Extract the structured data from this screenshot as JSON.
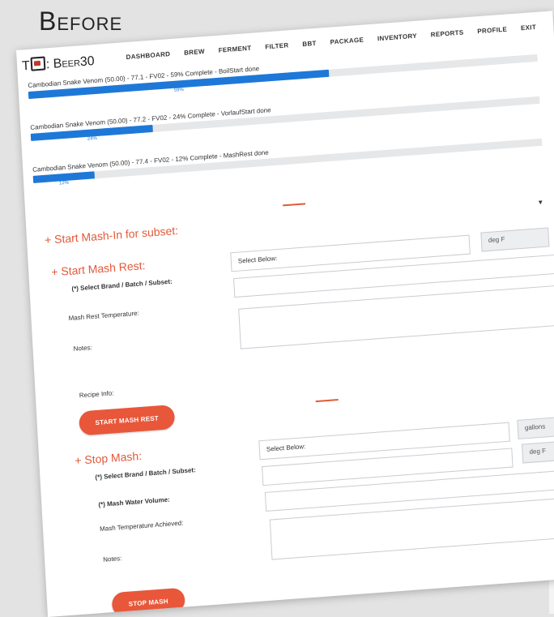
{
  "banner": {
    "title": "Before"
  },
  "app": {
    "brand_prefix": "T",
    "brand_suffix": ": Beer30",
    "nav": [
      "DASHBOARD",
      "BREW",
      "FERMENT",
      "FILTER",
      "BBT",
      "PACKAGE",
      "INVENTORY",
      "REPORTS",
      "PROFILE",
      "EXIT"
    ]
  },
  "jobs": [
    {
      "label": "Cambodian Snake Venom (50.00) - 77.1 - FV02 - 59% Complete - BoilStart done",
      "progress": 59,
      "progress_text": "59%"
    },
    {
      "label": "Cambodian Snake Venom (50.00) - 77.2 - FV02 - 24% Complete - VorlaufStart done",
      "progress": 24,
      "progress_text": "24%"
    },
    {
      "label": "Cambodian Snake Venom (50.00) - 77.4 - FV02 - 12% Complete - MashRest done",
      "progress": 12,
      "progress_text": "12%"
    }
  ],
  "mash_in": {
    "title": "+ Start Mash-In for subset:"
  },
  "mash_rest": {
    "title": "+ Start Mash Rest:",
    "select_label": "(*) Select Brand / Batch / Subset:",
    "select_value": "Select Below:",
    "temp_label": "Mash Rest Temperature:",
    "temp_unit": "deg F",
    "notes_label": "Notes:",
    "recipe_label": "Recipe Info:",
    "button": "START MASH REST"
  },
  "stop_mash": {
    "title": "+ Stop Mash:",
    "select_label": "(*) Select Brand / Batch / Subset:",
    "select_value": "Select Below:",
    "volume_label": "(*) Mash Water Volume:",
    "volume_unit": "gallons",
    "temp_label": "Mash Temperature Achieved:",
    "temp_unit": "deg F",
    "notes_label": "Notes:",
    "button": "STOP MASH"
  }
}
